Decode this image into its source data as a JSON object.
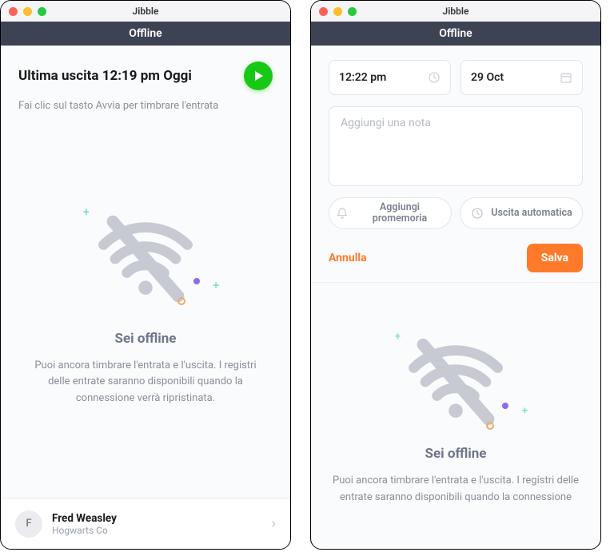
{
  "app_title": "Jibble",
  "status_label": "Offline",
  "left": {
    "headline": "Ultima uscita 12:19 pm Oggi",
    "subtext": "Fai clic sul tasto Avvia per timbrare l'entrata",
    "offline_title": "Sei offline",
    "offline_desc": "Puoi ancora timbrare l'entrata e l'uscita. I registri delle entrate saranno disponibili quando la connessione verrà ripristinata.",
    "user": {
      "initial": "F",
      "name": "Fred Weasley",
      "company": "Hogwarts Co"
    }
  },
  "right": {
    "time_value": "12:22 pm",
    "date_value": "29 Oct",
    "note_placeholder": "Aggiungi una nota",
    "chip_reminder": "Aggiungi promemoria",
    "chip_auto": "Uscita automatica",
    "cancel": "Annulla",
    "save": "Salva",
    "offline_title": "Sei offline",
    "offline_desc": "Puoi ancora timbrare l'entrata e l'uscita. I registri delle entrate saranno disponibili quando la connessione"
  }
}
